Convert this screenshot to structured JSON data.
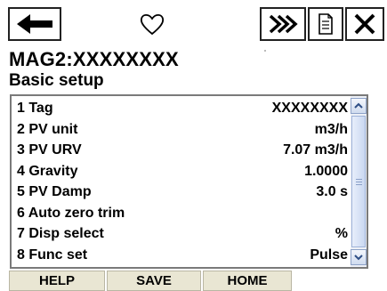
{
  "toolbar": {
    "back_icon": "left-arrow-icon",
    "favorite_icon": "heart-outline-icon",
    "forward_icon": "double-chevron-right-icon",
    "document_icon": "document-icon",
    "close_icon": "close-x-icon"
  },
  "header": {
    "device_title": "MAG2:XXXXXXXX",
    "page_title": "Basic setup"
  },
  "menu": {
    "items": [
      {
        "label": "1 Tag",
        "value": "XXXXXXXX"
      },
      {
        "label": "2 PV unit",
        "value": "m3/h"
      },
      {
        "label": "3 PV URV",
        "value": "7.07 m3/h"
      },
      {
        "label": "4 Gravity",
        "value": "1.0000"
      },
      {
        "label": "5 PV Damp",
        "value": "3.0 s"
      },
      {
        "label": "6 Auto zero trim",
        "value": ""
      },
      {
        "label": "7 Disp select",
        "value": "%"
      },
      {
        "label": "8 Func set",
        "value": "Pulse"
      }
    ]
  },
  "footer": {
    "help_label": "HELP",
    "save_label": "SAVE",
    "home_label": "HOME"
  },
  "colors": {
    "button_face": "#e9e6d3",
    "scrollbar_accent": "#8da2c8"
  }
}
